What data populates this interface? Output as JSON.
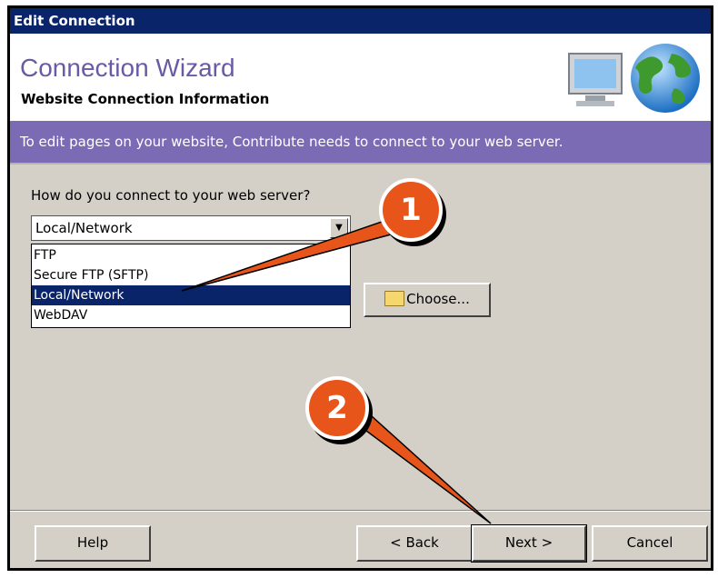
{
  "window": {
    "title": "Edit Connection"
  },
  "header": {
    "title": "Connection Wizard",
    "subtitle": "Website Connection Information",
    "icon": "globe-computer-icon"
  },
  "banner": {
    "text": "To edit pages on your website, Contribute needs to connect to your web server."
  },
  "form": {
    "question": "How do you connect to your web server?",
    "selected": "Local/Network",
    "options": [
      "FTP",
      "Secure FTP (SFTP)",
      "Local/Network",
      "WebDAV"
    ],
    "choose_label": "Choose..."
  },
  "buttons": {
    "help": "Help",
    "back": "< Back",
    "next": "Next >",
    "cancel": "Cancel"
  },
  "callouts": {
    "first": "1",
    "second": "2",
    "color": "#e8551a"
  },
  "colors": {
    "titlebar": "#0a246a",
    "banner": "#7b6bb5",
    "wizard_title": "#6a5aa6"
  }
}
